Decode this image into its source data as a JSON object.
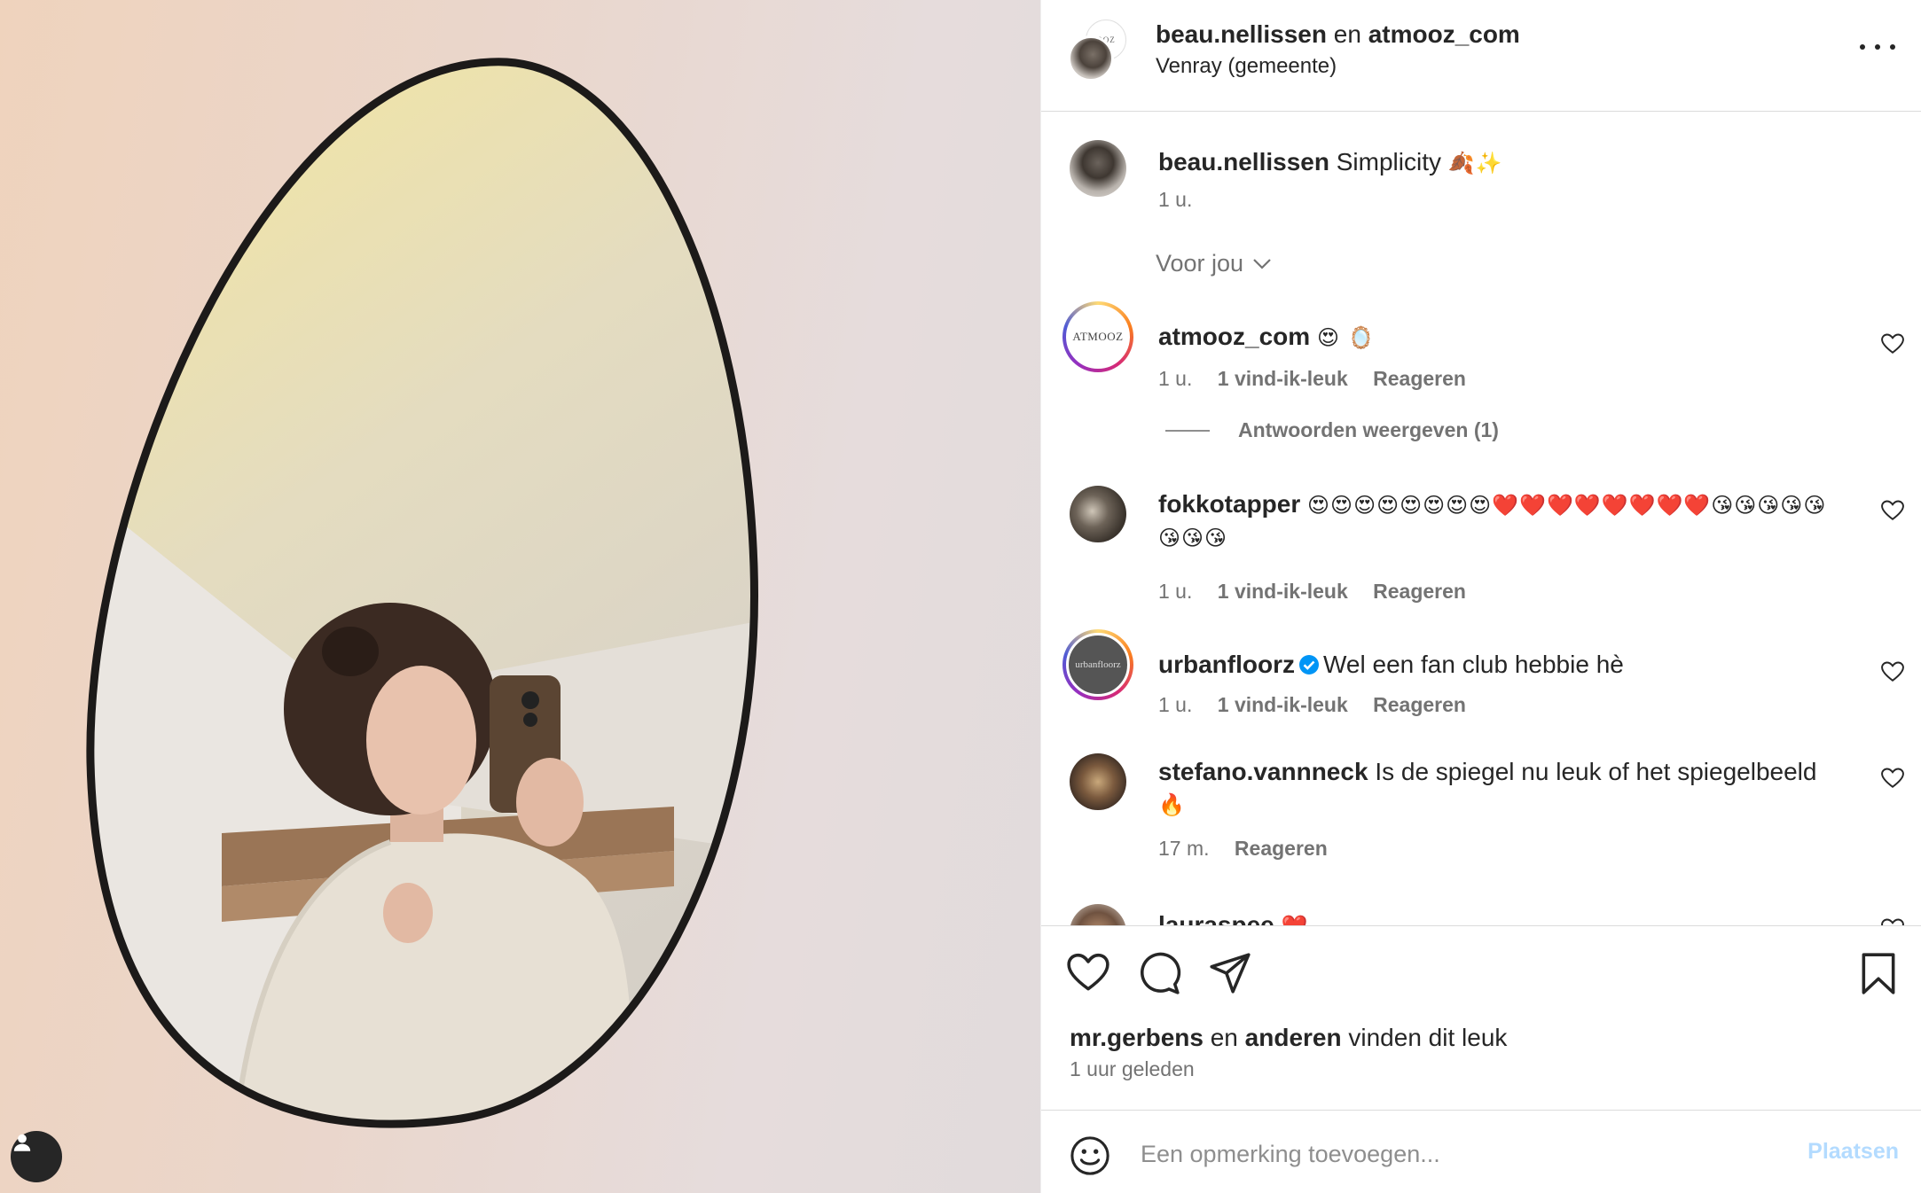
{
  "header": {
    "user1": "beau.nellissen",
    "joiner": "en",
    "user2": "atmooz_com",
    "location": "Venray (gemeente)",
    "avatar_logo_text": "OOZ"
  },
  "caption": {
    "username": "beau.nellissen",
    "text": "Simplicity",
    "emoji": "🍂✨",
    "time": "1 u."
  },
  "section": {
    "label": "Voor jou"
  },
  "comments": [
    {
      "username": "atmooz_com",
      "text": "",
      "emoji": "😍 🪞",
      "avatar_text": "ATMOOZ",
      "time": "1 u.",
      "likes": "1 vind-ik-leuk",
      "reply": "Reageren",
      "view_replies": "Antwoorden weergeven (1)"
    },
    {
      "username": "fokkotapper",
      "text": "",
      "emoji": "😍😍😍😍😍😍😍😍❤️❤️❤️❤️❤️❤️❤️❤️😘😘😘😘😘😘😘😘",
      "time": "1 u.",
      "likes": "1 vind-ik-leuk",
      "reply": "Reageren"
    },
    {
      "username": "urbanfloorz",
      "verified": true,
      "text": "Wel een fan club hebbie hè",
      "avatar_text": "urbanfloorz",
      "time": "1 u.",
      "likes": "1 vind-ik-leuk",
      "reply": "Reageren"
    },
    {
      "username": "stefano.vannneck",
      "text": "Is de spiegel nu leuk of het spiegelbeeld",
      "emoji": "🔥",
      "time": "17 m.",
      "reply": "Reageren"
    },
    {
      "username": "lauraspee",
      "emoji": "❤️"
    }
  ],
  "footer": {
    "liker": "mr.gerbens",
    "joiner": "en",
    "others": "anderen",
    "suffix": "vinden dit leuk",
    "time": "1 uur geleden"
  },
  "composer": {
    "placeholder": "Een opmerking toevoegen...",
    "post_label": "Plaatsen"
  },
  "icons": {
    "like": "heart-icon",
    "comment": "comment-icon",
    "share": "send-icon",
    "save": "bookmark-icon",
    "more": "more-icon",
    "emoji": "emoji-icon",
    "tag": "user-tag-icon"
  },
  "colors": {
    "text": "#262626",
    "secondary": "#737373",
    "divider": "#dbdbdb",
    "post_button": "#b3dbff",
    "verified": "#0095f6"
  }
}
